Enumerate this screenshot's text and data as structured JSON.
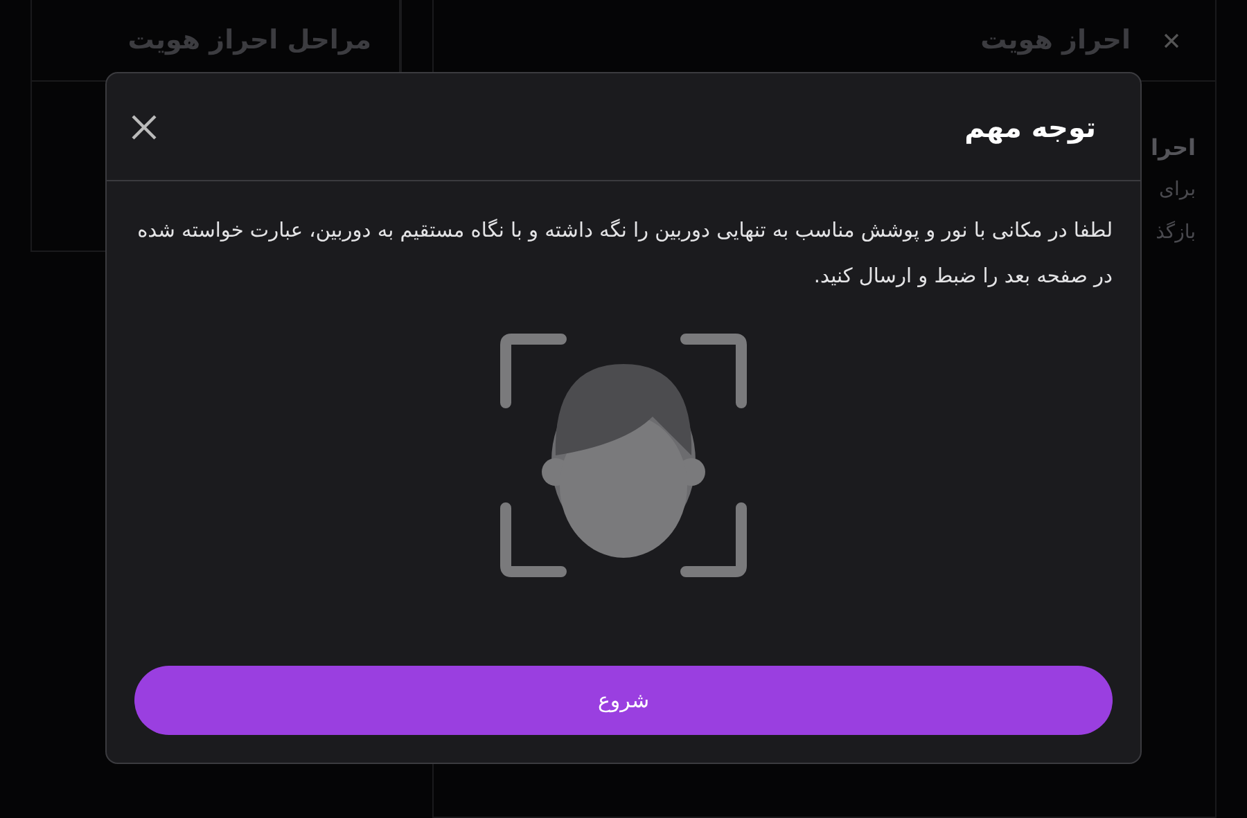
{
  "background": {
    "title": "احراز هویت",
    "steps_title": "مراحل احراز هویت",
    "section_title": "احرا",
    "lines": [
      "برای",
      "بازگذ"
    ]
  },
  "dialog": {
    "title": "توجه مهم",
    "message": "لطفا در مکانی با نور و پوشش مناسب به تنهایی دوربین را نگه داشته و با نگاه مستقیم به دوربین، عبارت خواسته شده در صفحه بعد را ضبط و ارسال کنید.",
    "button": "شروع"
  }
}
